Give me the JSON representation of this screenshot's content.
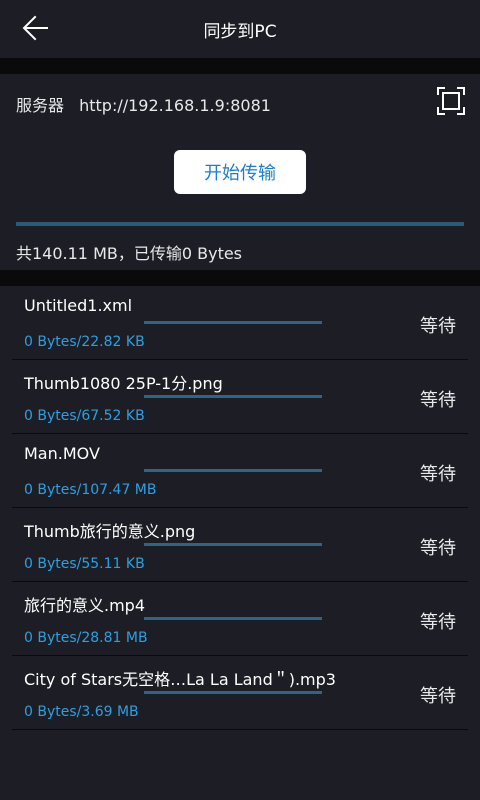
{
  "header": {
    "title": "同步到PC",
    "back_icon": "arrow-left-icon"
  },
  "server": {
    "label": "服务器",
    "address": "http://192.168.1.9:8081",
    "scan_icon": "scan-frame-icon"
  },
  "start_button": "开始传输",
  "total": {
    "text": "共140.11 MB，已传输0 Bytes",
    "progress": 0
  },
  "files": [
    {
      "name": "Untitled1.xml",
      "size": "0 Bytes/22.82 KB",
      "status": "等待",
      "progress": 0
    },
    {
      "name": "Thumb1080 25P-1分.png",
      "size": "0 Bytes/67.52 KB",
      "status": "等待",
      "progress": 0
    },
    {
      "name": "Man.MOV",
      "size": "0 Bytes/107.47 MB",
      "status": "等待",
      "progress": 0
    },
    {
      "name": "Thumb旅行的意义.png",
      "size": "0 Bytes/55.11 KB",
      "status": "等待",
      "progress": 0
    },
    {
      "name": "旅行的意义.mp4",
      "size": "0 Bytes/28.81 MB",
      "status": "等待",
      "progress": 0
    },
    {
      "name": "City of Stars无空格…La La Land＂).mp3",
      "size": "0 Bytes/3.69 MB",
      "status": "等待",
      "progress": 0
    }
  ],
  "colors": {
    "background": "#1d1e25",
    "separator": "#0a0a0c",
    "accent": "#2d9fe0",
    "progress_track": "#2f6584"
  }
}
